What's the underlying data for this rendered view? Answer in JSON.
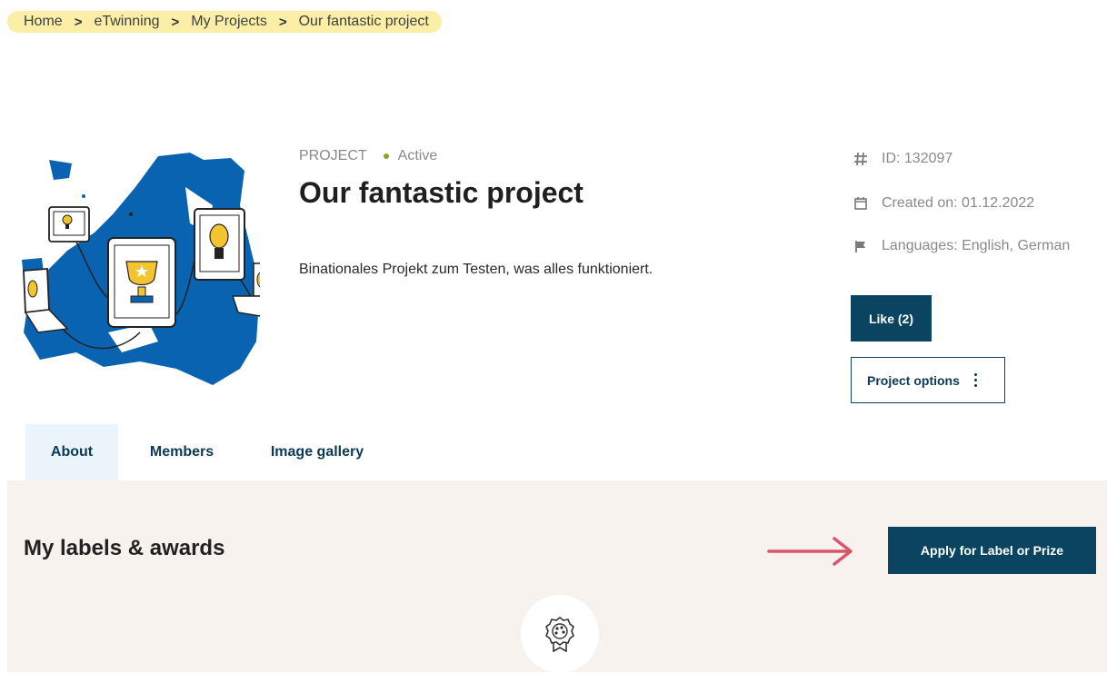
{
  "breadcrumb": {
    "items": [
      "Home",
      "eTwinning",
      "My Projects",
      "Our fantastic project"
    ],
    "separator": ">"
  },
  "project": {
    "type_label": "PROJECT",
    "status": "Active",
    "title": "Our fantastic project",
    "description": "Binationales Projekt zum Testen, was alles funktioniert."
  },
  "details": {
    "id": "ID: 132097",
    "created": "Created on: 01.12.2022",
    "languages": "Languages: English, German"
  },
  "actions": {
    "like_label": "Like (2)",
    "options_label": "Project options"
  },
  "tabs": [
    {
      "label": "About",
      "active": true
    },
    {
      "label": "Members",
      "active": false
    },
    {
      "label": "Image gallery",
      "active": false
    }
  ],
  "labels_section": {
    "title": "My labels & awards",
    "apply_label": "Apply for Label or Prize"
  },
  "colors": {
    "primary": "#0b4461",
    "status_active": "#8aa62a",
    "breadcrumb_highlight": "#fbeea6",
    "section_bg": "#f8f2ee",
    "tab_active_bg": "#eaf4fa",
    "arrow": "#d9566a"
  },
  "icons": [
    "hash-icon",
    "calendar-icon",
    "flag-icon",
    "kebab-icon",
    "award-badge-icon",
    "arrow-right-icon"
  ]
}
